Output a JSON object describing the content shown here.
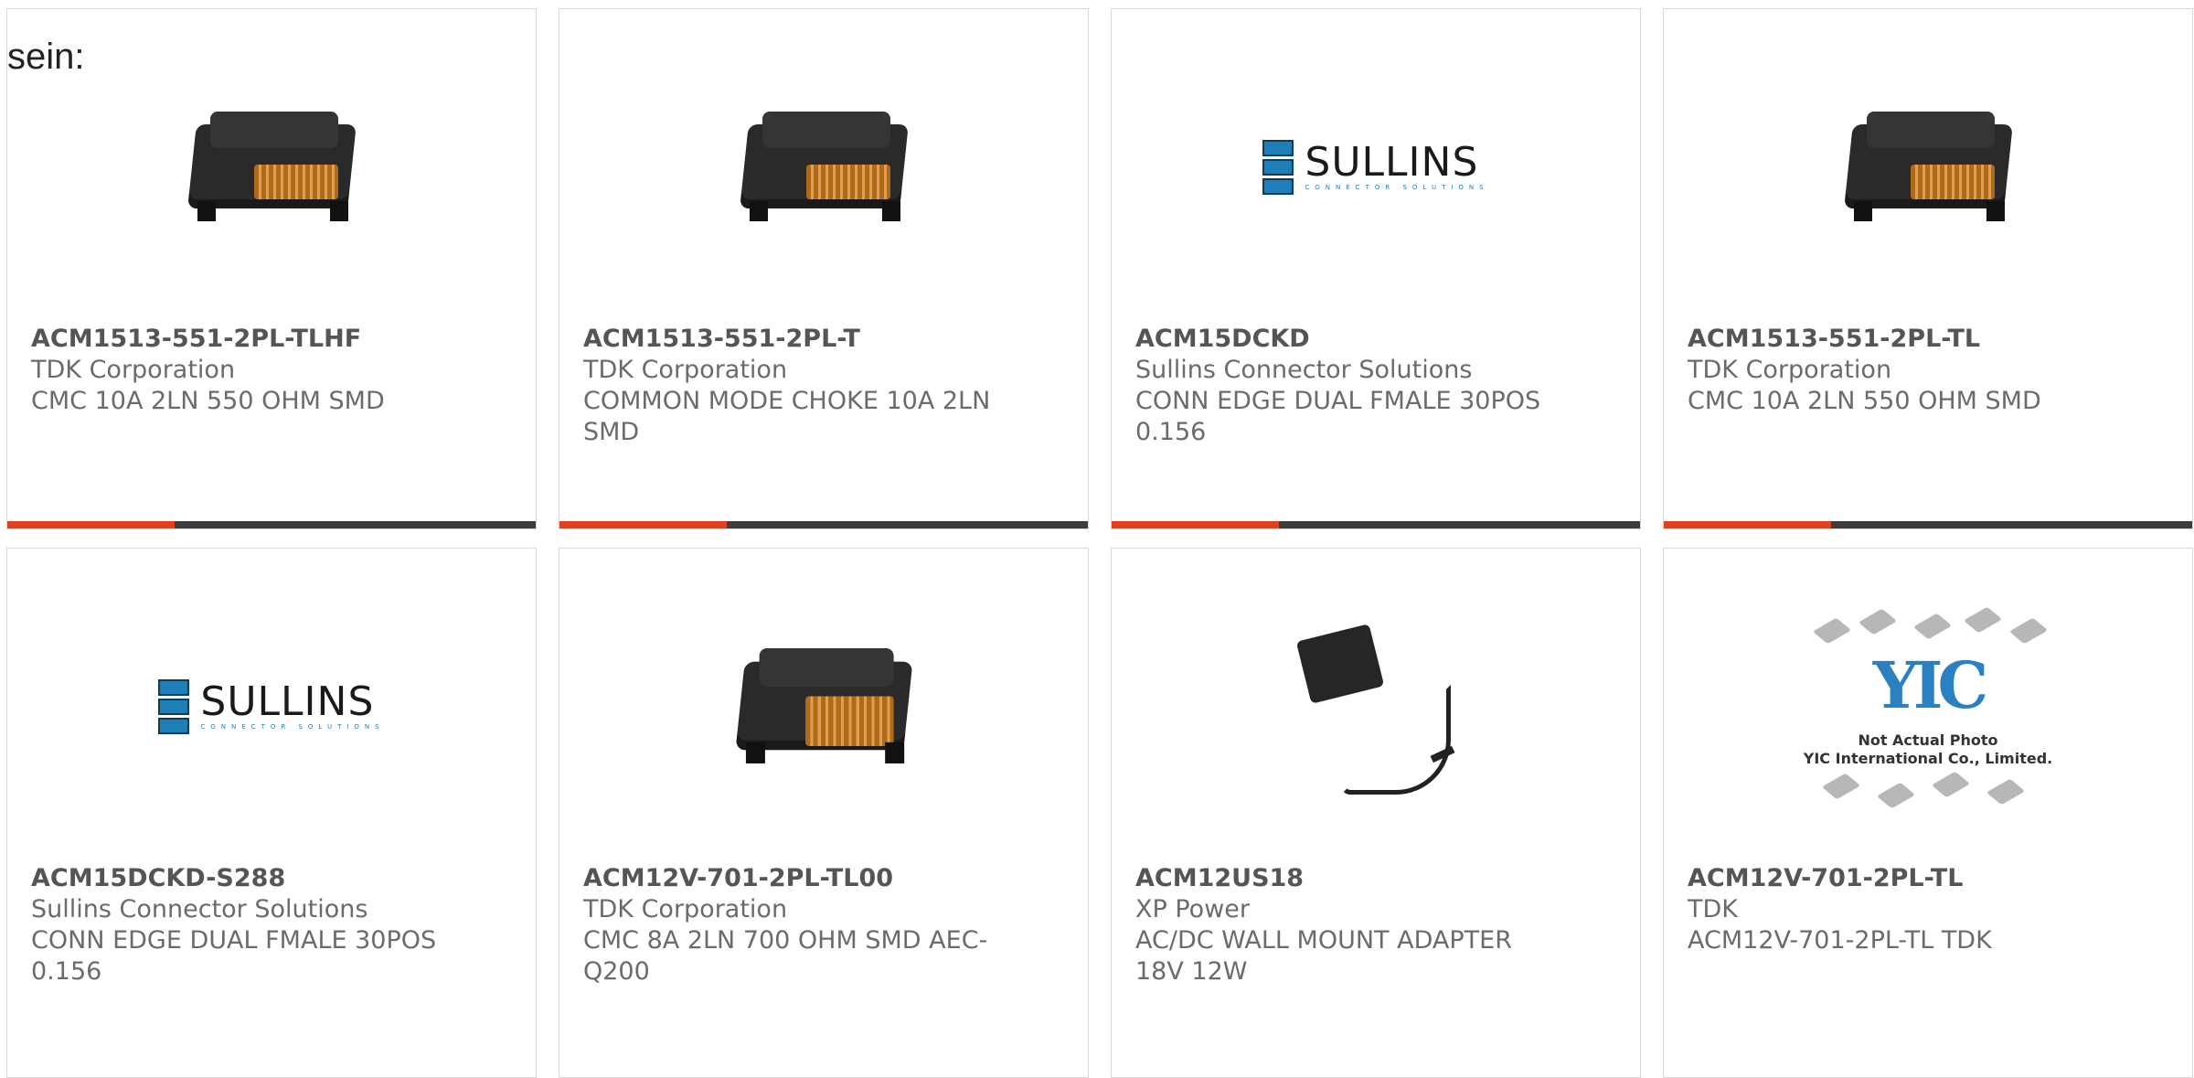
{
  "intro_text": "sein:",
  "products": [
    {
      "part_number": "ACM1513-551-2PL-TLHF",
      "manufacturer": "TDK Corporation",
      "description": "CMC 10A 2LN 550 OHM SMD",
      "image": "choke-smd"
    },
    {
      "part_number": "ACM1513-551-2PL-T",
      "manufacturer": "TDK Corporation",
      "description": "COMMON MODE CHOKE 10A 2LN SMD",
      "image": "choke-smd"
    },
    {
      "part_number": "ACM15DCKD",
      "manufacturer": "Sullins Connector Solutions",
      "description": "CONN EDGE DUAL FMALE 30POS 0.156",
      "image": "sullins-logo"
    },
    {
      "part_number": "ACM1513-551-2PL-TL",
      "manufacturer": "TDK Corporation",
      "description": "CMC 10A 2LN 550 OHM SMD",
      "image": "choke-smd"
    },
    {
      "part_number": "ACM15DCKD-S288",
      "manufacturer": "Sullins Connector Solutions",
      "description": "CONN EDGE DUAL FMALE 30POS 0.156",
      "image": "sullins-logo"
    },
    {
      "part_number": "ACM12V-701-2PL-TL00",
      "manufacturer": "TDK Corporation",
      "description": "CMC 8A 2LN 700 OHM SMD AEC-Q200",
      "image": "choke-smd"
    },
    {
      "part_number": "ACM12US18",
      "manufacturer": "XP Power",
      "description": "AC/DC WALL MOUNT ADAPTER 18V 12W",
      "image": "wall-adapter"
    },
    {
      "part_number": "ACM12V-701-2PL-TL",
      "manufacturer": "TDK",
      "description": "ACM12V-701-2PL-TL TDK",
      "image": "yic-placeholder"
    }
  ],
  "logos": {
    "sullins_word": "SULLINS",
    "sullins_tag": "CONNECTOR SOLUTIONS",
    "yic_mark": "YIC",
    "yic_line1": "Not Actual Photo",
    "yic_line2": "YIC International Co., Limited."
  },
  "colors": {
    "accent": "#e2401c",
    "bar": "#3d3d3d",
    "text": "#6b6b6b",
    "border": "#d9d9d9"
  }
}
